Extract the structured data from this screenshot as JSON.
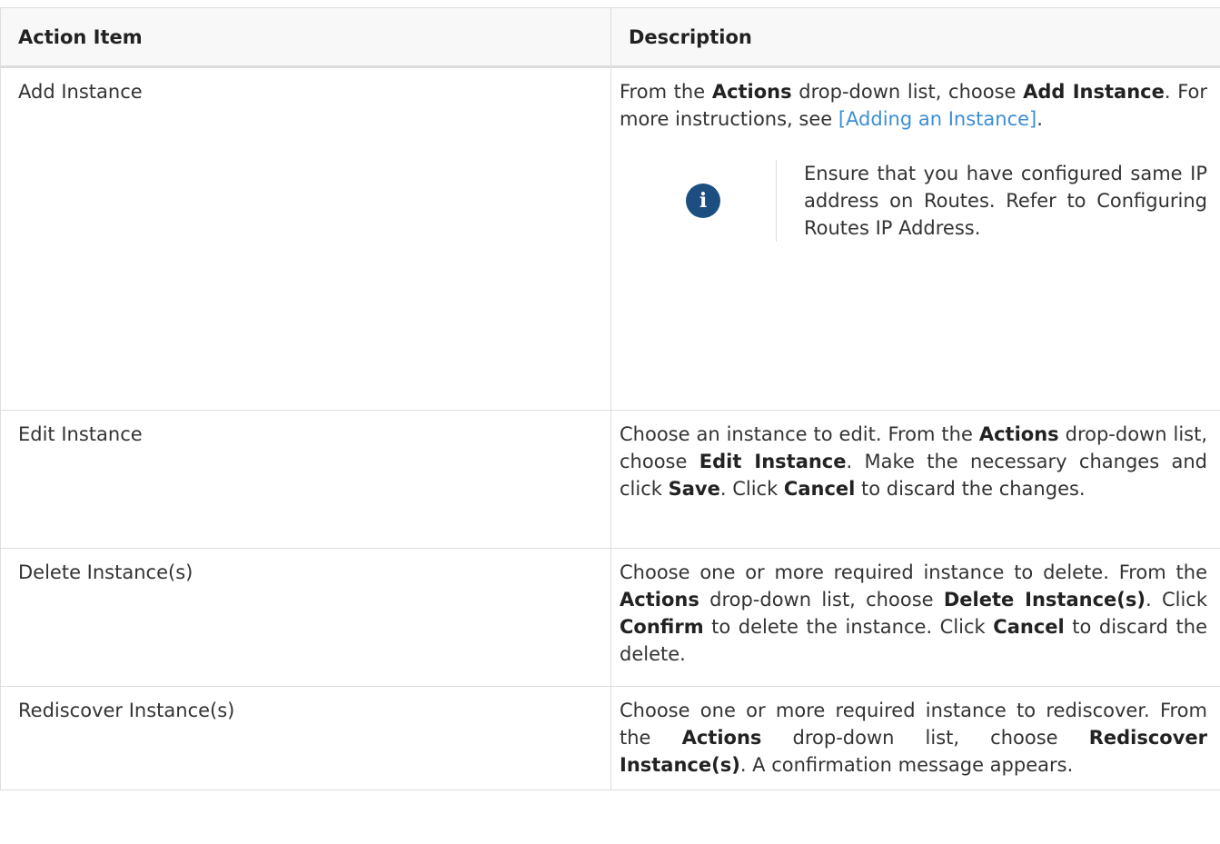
{
  "table": {
    "headers": {
      "action": "Action Item",
      "description": "Description"
    },
    "rows": [
      {
        "action": "Add Instance",
        "desc": {
          "t1": "From the ",
          "b1": "Actions",
          "t2": " drop-down list, choose ",
          "b2": "Add Instance",
          "t3": ". For more instructions, see ",
          "link": "[Adding an Instance]",
          "t4": "."
        },
        "note": {
          "icon": "info-icon",
          "text": "Ensure that you have configured same IP address on Routes. Refer to Configuring Routes IP Address."
        }
      },
      {
        "action": "Edit Instance",
        "desc": {
          "t1": "Choose an instance to edit. From the ",
          "b1": "Actions",
          "t2": " drop-down list, choose ",
          "b2": "Edit Instance",
          "t3": ". Make the necessary changes and click ",
          "b3": "Save",
          "t4": ". Click ",
          "b4": "Cancel",
          "t5": " to discard the changes."
        }
      },
      {
        "action": "Delete Instance(s)",
        "desc": {
          "t1": "Choose one or more required instance to delete. From the ",
          "b1": "Actions",
          "t2": " drop-down list, choose ",
          "b2": "Delete Instance(s)",
          "t3": ". Click ",
          "b3": "Confirm",
          "t4": " to delete the instance. Click ",
          "b4": "Cancel",
          "t5": " to discard the delete."
        }
      },
      {
        "action": "Rediscover Instance(s)",
        "desc": {
          "t1": "Choose one or more required instance to rediscover. From the ",
          "b1": "Actions",
          "t2": " drop-down list, choose ",
          "b2": "Rediscover Instance(s)",
          "t3": ". A confirmation message appears."
        }
      }
    ]
  },
  "colors": {
    "link": "#3c8ed3",
    "icon_bg": "#1c4e80",
    "header_bg": "#f7f8f7",
    "border": "#dedede"
  }
}
